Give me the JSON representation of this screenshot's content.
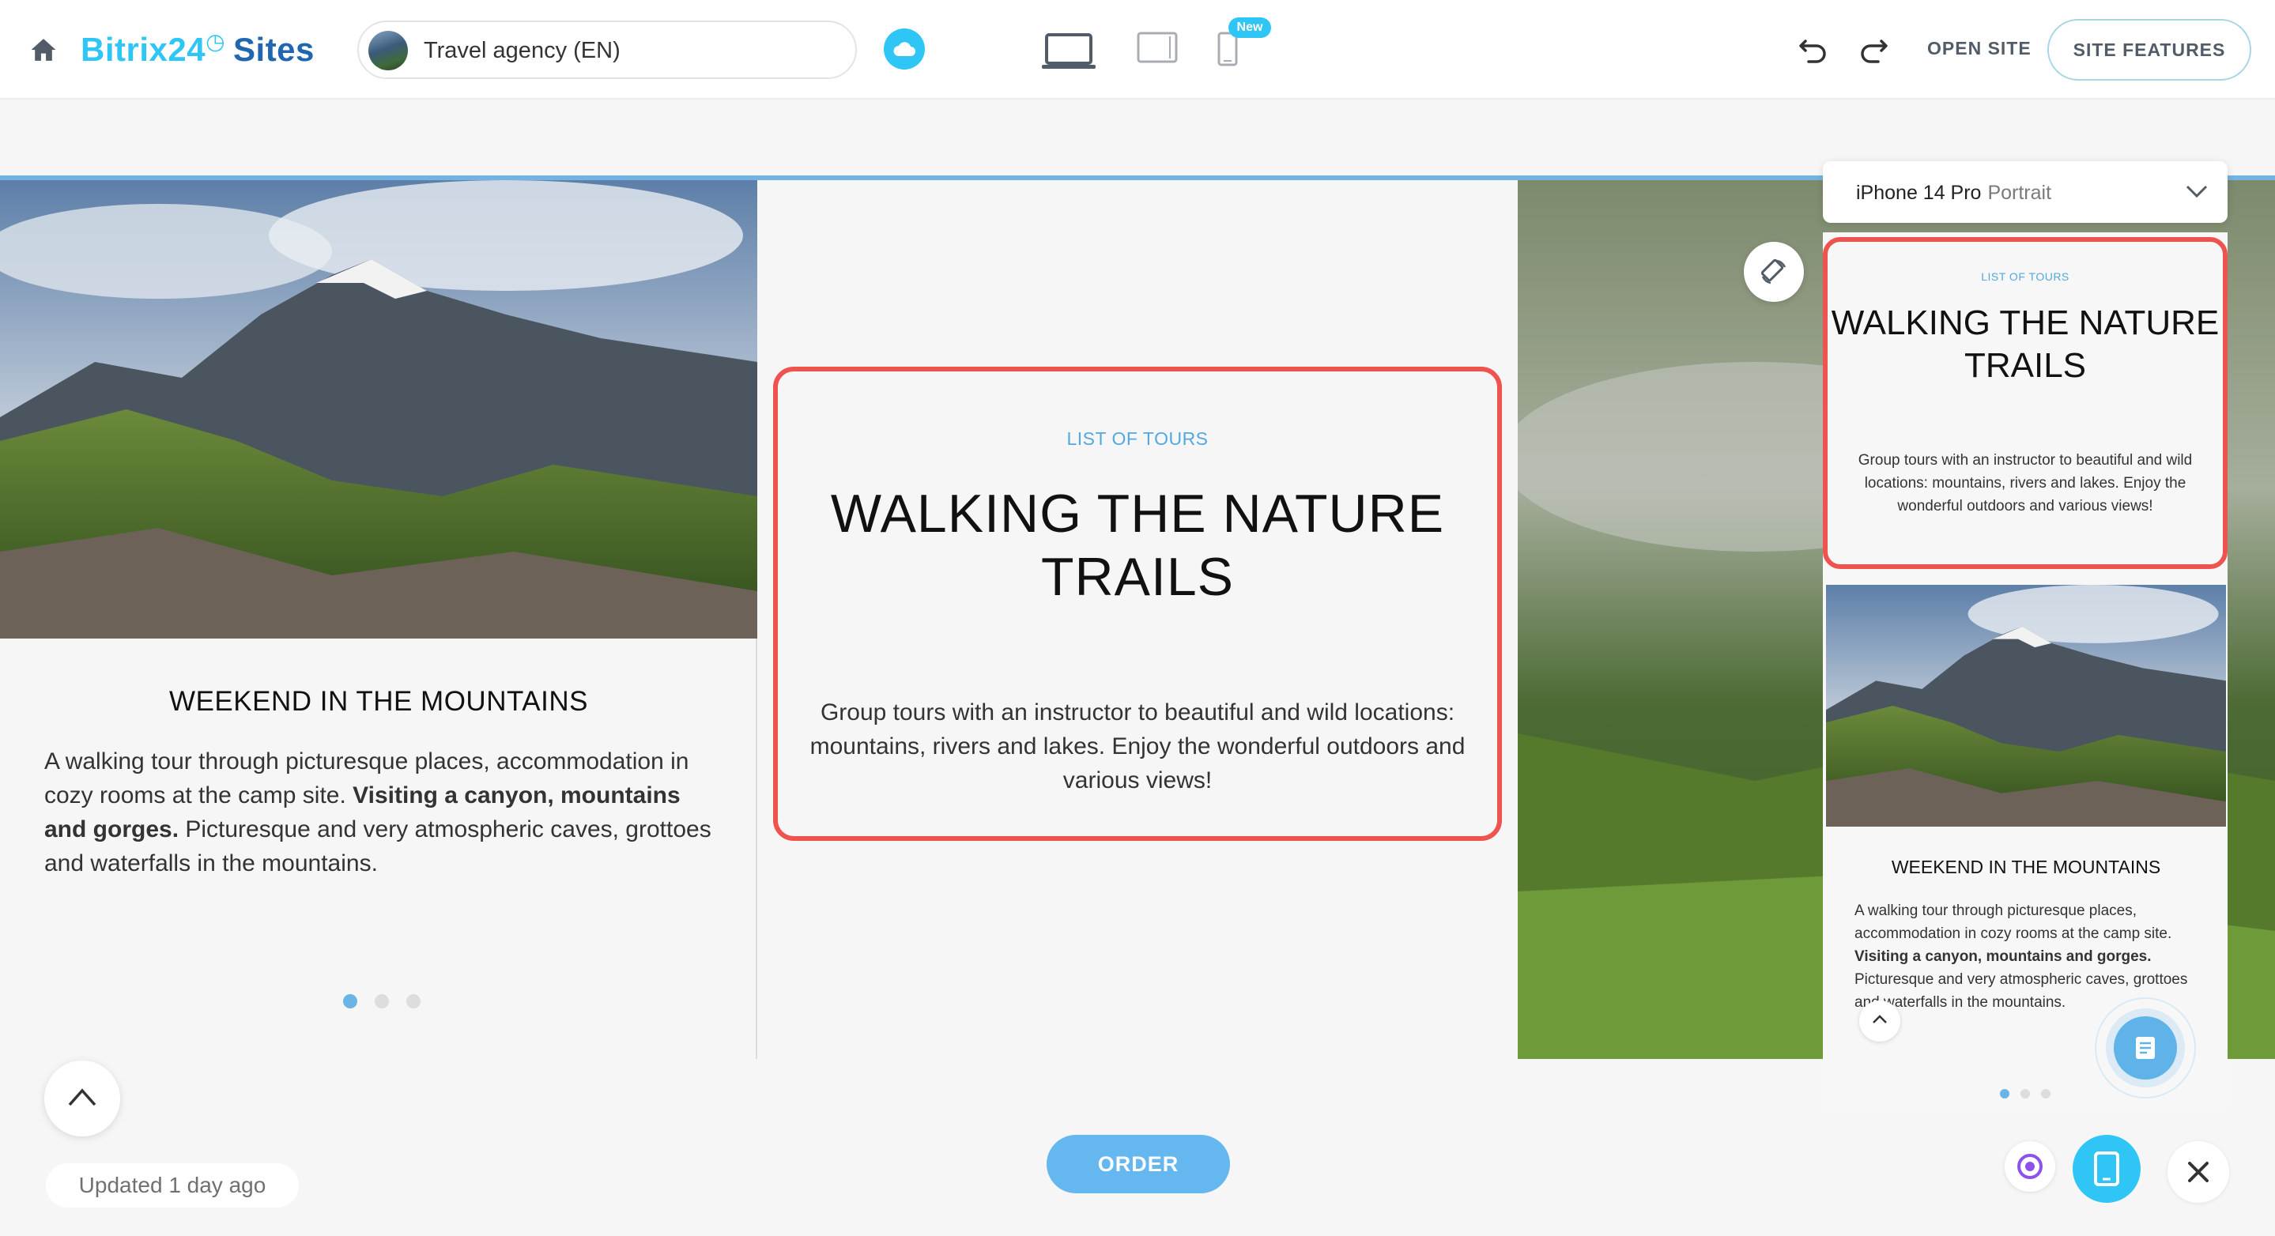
{
  "header": {
    "brand_name": "Bitrix24",
    "brand_clock": "◷",
    "brand_product": "Sites",
    "site_name": "Travel agency (EN)",
    "new_badge": "New",
    "open_site": "OPEN SITE",
    "site_features": "SITE FEATURES",
    "icons": [
      "home-icon",
      "cloud-icon",
      "laptop-icon",
      "tablet-icon",
      "phone-icon",
      "undo-icon",
      "redo-icon"
    ],
    "accent_color": "#2fc6f6"
  },
  "preview": {
    "left_card": {
      "title": "WEEKEND IN THE MOUNTAINS",
      "desc_plain_1": "A walking tour through picturesque places, accommodation in cozy rooms at the camp site. ",
      "desc_bold": "Visiting a canyon, mountains and gorges.",
      "desc_plain_2": " Picturesque and very atmospheric caves, grottoes and waterfalls in the mountains.",
      "slider_dots": 3,
      "active_dot": 1
    },
    "center_block": {
      "subtitle": "LIST OF TOURS",
      "title": "WALKING THE NATURE TRAILS",
      "intro": "Group tours with an instructor to beautiful and wild locations: mountains, rivers and lakes. Enjoy the wonderful outdoors and various views!",
      "highlight_color": "#ef5350"
    },
    "order_button": "ORDER",
    "updated": "Updated 1 day ago"
  },
  "phone_preview": {
    "device": "iPhone 14 Pro",
    "orientation": "Portrait",
    "subtitle": "LIST OF TOURS",
    "title": "WALKING THE NATURE TRAILS",
    "intro": "Group tours with an instructor to beautiful and wild locations: mountains, rivers and lakes. Enjoy the wonderful outdoors and various views!",
    "card_title": "WEEKEND IN THE MOUNTAINS",
    "card_plain_1": "A walking tour through picturesque places, accommodation in cozy rooms at the camp site. ",
    "card_bold": "Visiting a canyon, mountains and gorges.",
    "card_plain_2": " Picturesque and very atmospheric caves, grottoes and waterfalls in the mountains.",
    "slider_dots": 3,
    "active_dot": 1
  }
}
